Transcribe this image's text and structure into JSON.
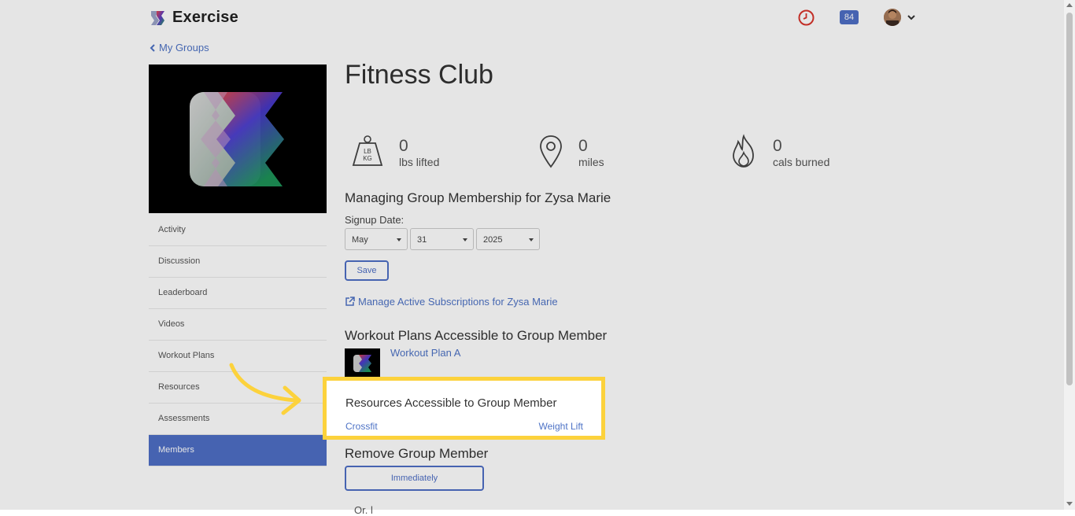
{
  "header": {
    "app_name": "Exercise",
    "notification_count": "84",
    "icons": [
      "logo-icon",
      "clock-icon",
      "avatar",
      "chevron-down-icon"
    ]
  },
  "back_link": {
    "label": "My Groups"
  },
  "group": {
    "title": "Fitness Club"
  },
  "stats": [
    {
      "icon": "weight-icon",
      "value": "0",
      "label": "lbs lifted"
    },
    {
      "icon": "location-pin-icon",
      "value": "0",
      "label": "miles"
    },
    {
      "icon": "flame-icon",
      "value": "0",
      "label": "cals burned"
    }
  ],
  "sidebar": {
    "items": [
      {
        "label": "Activity"
      },
      {
        "label": "Discussion"
      },
      {
        "label": "Leaderboard"
      },
      {
        "label": "Videos"
      },
      {
        "label": "Workout Plans"
      },
      {
        "label": "Resources"
      },
      {
        "label": "Assessments"
      },
      {
        "label": "Members",
        "active": true
      }
    ]
  },
  "membership": {
    "heading": "Managing Group Membership for Zysa Marie",
    "signup_label": "Signup Date:",
    "month": "May",
    "day": "31",
    "year": "2025",
    "save_label": "Save",
    "subscriptions_link": "Manage Active Subscriptions for Zysa Marie"
  },
  "workout_plans": {
    "heading": "Workout Plans Accessible to Group Member",
    "items": [
      "Workout Plan A"
    ]
  },
  "resources": {
    "heading": "Resources Accessible to Group Member",
    "items": [
      "Crossfit",
      "Weight Lift"
    ]
  },
  "remove": {
    "heading": "Remove Group Member",
    "button_label": "Immediately",
    "partial_text": "Or. l"
  },
  "colors": {
    "accent": "#4e6fc6",
    "highlight": "#fcd23c",
    "alert": "#d9342b"
  }
}
